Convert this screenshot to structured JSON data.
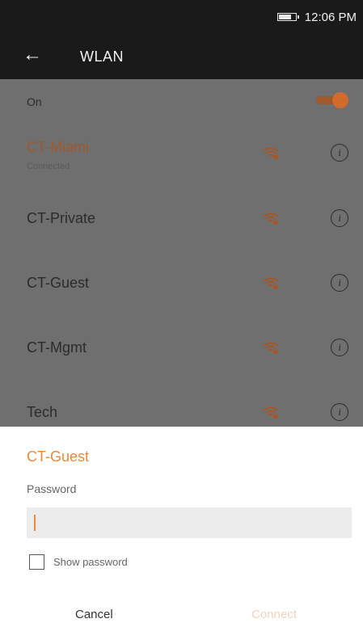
{
  "status_bar": {
    "time": "12:06 PM"
  },
  "app_bar": {
    "title": "WLAN"
  },
  "wlan_toggle": {
    "label": "On",
    "state": "on"
  },
  "networks": [
    {
      "name": "CT-Miami",
      "status": "Connected",
      "active": true
    },
    {
      "name": "CT-Private",
      "status": "",
      "active": false
    },
    {
      "name": "CT-Guest",
      "status": "",
      "active": false
    },
    {
      "name": "CT-Mgmt",
      "status": "",
      "active": false
    },
    {
      "name": "Tech",
      "status": "",
      "active": false
    }
  ],
  "dialog": {
    "network_name": "CT-Guest",
    "password_label": "Password",
    "password_value": "",
    "show_password_label": "Show password",
    "cancel_label": "Cancel",
    "connect_label": "Connect"
  },
  "colors": {
    "accent": "#e8893b",
    "scrim_list": "#6f6f6f",
    "toolbar": "#1a1a1a"
  },
  "icons": {
    "back": "arrow-left-icon",
    "wifi": "wifi-lock-icon",
    "info": "info-icon",
    "battery": "battery-icon"
  }
}
